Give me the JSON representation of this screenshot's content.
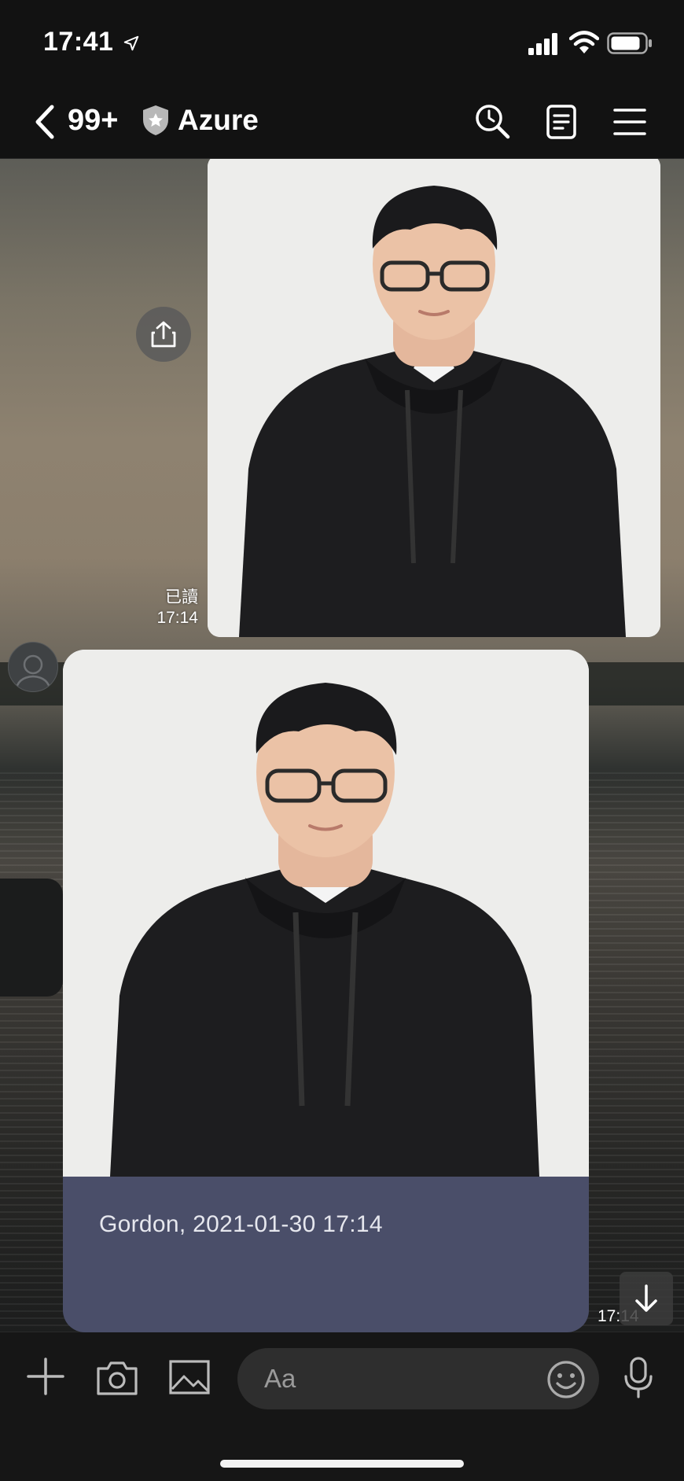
{
  "status_bar": {
    "time": "17:41",
    "icons": [
      "location-arrow-icon",
      "cellular-signal-icon",
      "wifi-icon",
      "battery-icon"
    ]
  },
  "header": {
    "back_icon": "chevron-left-icon",
    "unread_count": "99+",
    "shield_icon": "shield-star-icon",
    "title": "Azure",
    "actions": [
      "search-icon",
      "notes-icon",
      "menu-icon"
    ]
  },
  "chat": {
    "messages": [
      {
        "direction": "sent",
        "kind": "photo",
        "read_status": "已讀",
        "time": "17:14"
      },
      {
        "direction": "received",
        "kind": "photo-card",
        "caption": "Gordon, 2021-01-30 17:14",
        "time": "17:14"
      }
    ],
    "share_icon": "share-upload-icon",
    "scroll_down_icon": "arrow-down-icon"
  },
  "input_bar": {
    "placeholder": "Aa",
    "buttons": [
      "plus-icon",
      "camera-icon",
      "image-icon",
      "emoji-icon",
      "microphone-icon"
    ]
  },
  "colors": {
    "bar_background": "#121212",
    "caption_card": "#4a4e69",
    "input_field": "#2e2e2e"
  }
}
